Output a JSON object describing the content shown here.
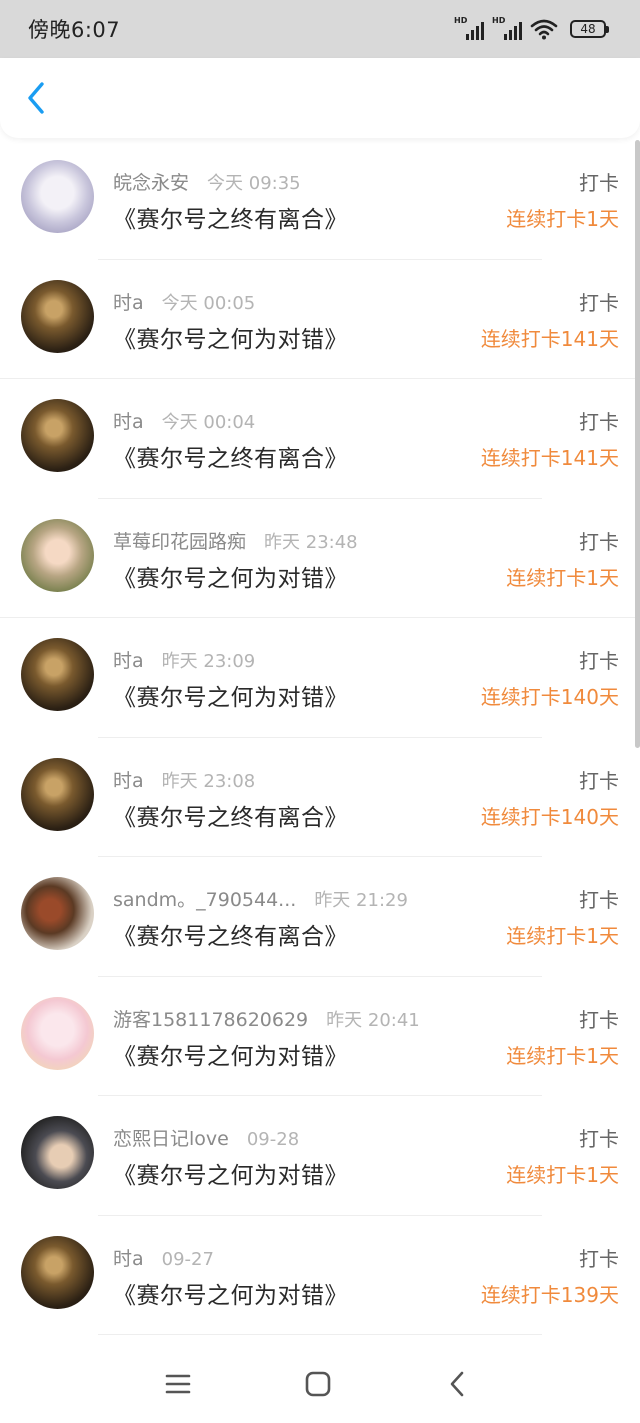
{
  "status_bar": {
    "time": "傍晚6:07",
    "signal1_label": "HD",
    "signal2_label": "HD",
    "battery": "48",
    "icons": [
      "signal-icon",
      "signal-icon",
      "wifi-icon",
      "battery-icon"
    ]
  },
  "header": {
    "back_icon": "chevron-left-icon",
    "accent_color": "#1a9df2"
  },
  "colors": {
    "streak": "#f08a3c",
    "name": "#8a8a8a",
    "time": "#b4b4b4"
  },
  "entries": [
    {
      "name": "皖念永安",
      "time": "今天 09:35",
      "title": "《赛尔号之终有离合》",
      "action": "打卡",
      "streak": "连续打卡1天",
      "avatar": "anime-avatar"
    },
    {
      "name": "时a",
      "time": "今天 00:05",
      "title": "《赛尔号之何为对错》",
      "action": "打卡",
      "streak": "连续打卡141天",
      "avatar": "dark-avatar"
    },
    {
      "name": "时a",
      "time": "今天 00:04",
      "title": "《赛尔号之终有离合》",
      "action": "打卡",
      "streak": "连续打卡141天",
      "avatar": "dark-avatar"
    },
    {
      "name": "草莓印花园路痴",
      "time": "昨天 23:48",
      "title": "《赛尔号之何为对错》",
      "action": "打卡",
      "streak": "连续打卡1天",
      "avatar": "girl-avatar"
    },
    {
      "name": "时a",
      "time": "昨天 23:09",
      "title": "《赛尔号之何为对错》",
      "action": "打卡",
      "streak": "连续打卡140天",
      "avatar": "dark-avatar"
    },
    {
      "name": "时a",
      "time": "昨天 23:08",
      "title": "《赛尔号之终有离合》",
      "action": "打卡",
      "streak": "连续打卡140天",
      "avatar": "dark-avatar"
    },
    {
      "name": "sandm。_790544...",
      "time": "昨天 21:29",
      "title": "《赛尔号之终有离合》",
      "action": "打卡",
      "streak": "连续打卡1天",
      "avatar": "bug-avatar"
    },
    {
      "name": "游客1581178620629",
      "time": "昨天 20:41",
      "title": "《赛尔号之何为对错》",
      "action": "打卡",
      "streak": "连续打卡1天",
      "avatar": "pink-avatar"
    },
    {
      "name": "恋熙日记love",
      "time": "09-28",
      "title": "《赛尔号之何为对错》",
      "action": "打卡",
      "streak": "连续打卡1天",
      "avatar": "boy-avatar"
    },
    {
      "name": "时a",
      "time": "09-27",
      "title": "《赛尔号之何为对错》",
      "action": "打卡",
      "streak": "连续打卡139天",
      "avatar": "dark-avatar"
    }
  ],
  "nav_bar": {
    "icons": [
      "menu-icon",
      "home-icon",
      "back-icon"
    ]
  }
}
